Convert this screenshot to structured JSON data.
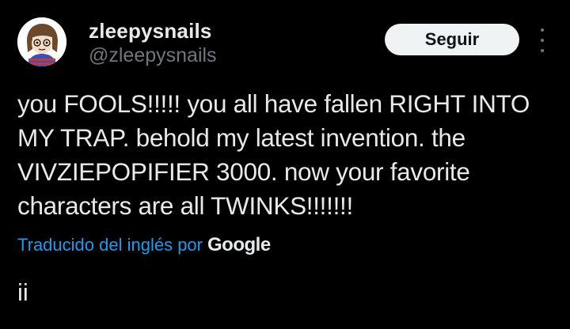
{
  "author": {
    "display_name": "zleepysnails",
    "handle": "@zleepysnails"
  },
  "follow_button": {
    "label": "Seguir"
  },
  "tweet": {
    "text": "you FOOLS!!!!! you all have fallen RIGHT INTO MY TRAP. behold my latest invention. the VIVZIEPOPIFIER 3000. now your favorite characters are all TWINKS!!!!!!!"
  },
  "translation": {
    "label": "Traducido del inglés por",
    "provider": "Google"
  },
  "extra_text": "ii",
  "icons": {
    "more": "more-options-icon",
    "avatar": "avatar-image"
  },
  "colors": {
    "background": "#000000",
    "primary_text": "#e7e9ea",
    "secondary_text": "#71767b",
    "link": "#1d9bf0",
    "follow_button_bg": "#eff3f4"
  }
}
